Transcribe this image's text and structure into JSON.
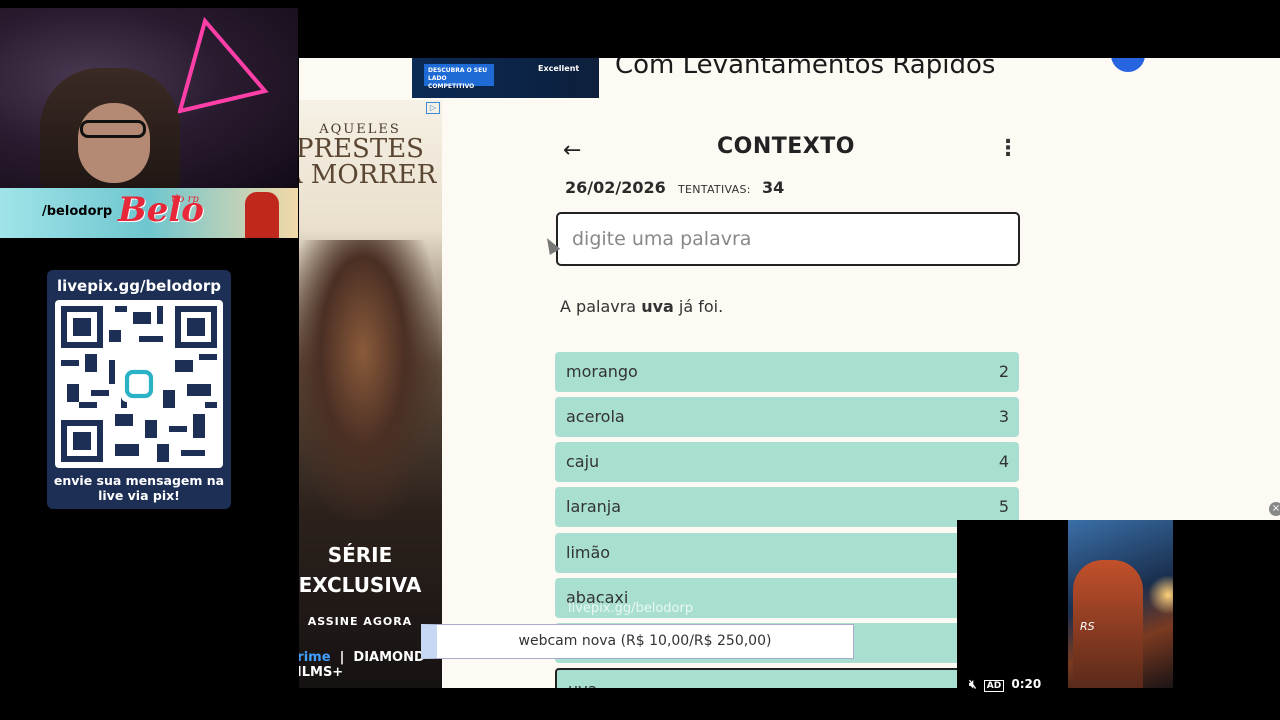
{
  "stream": {
    "handle": "/belodorp",
    "logo_text": "Belo",
    "logo_sub": "do rp",
    "livepix": {
      "url": "livepix.gg/belodorp",
      "message_line1": "envie sua mensagem na",
      "message_line2": "live via pix!"
    },
    "watermark": "livepix.gg/belodorp",
    "donation_text": "webcam nova (R$ 10,00/R$ 250,00)",
    "close_icon": "×",
    "video_time": "0:20",
    "video_ad_badge": "AD",
    "video_watermark": "RS"
  },
  "ads": {
    "top": {
      "badge_text": "DESCUBRA O SEU LADO COMPETITIVO",
      "badge2_text": "Excellent",
      "headline": "Com Levantamentos Rápidos"
    },
    "side": {
      "title_small": "AQUELES",
      "title_big1": "PRESTES",
      "title_big2": "A MORRER",
      "serie_line1": "SÉRIE",
      "serie_line2": "EXCLUSIVA",
      "cta": "ASSINE AGORA",
      "logo1": "prime",
      "logo2": "DIAMOND FILMS+"
    }
  },
  "game": {
    "title": "CONTEXTO",
    "back_icon": "←",
    "menu_icon": "⋮",
    "date": "26/02/2026",
    "tries_label": "TENTATIVAS:",
    "tries_value": "34",
    "input_placeholder": "digite uma palavra",
    "notice_prefix": "A palavra",
    "notice_word": "uva",
    "notice_suffix": "já foi.",
    "guesses": [
      {
        "word": "morango",
        "rank": "2"
      },
      {
        "word": "acerola",
        "rank": "3"
      },
      {
        "word": "caju",
        "rank": "4"
      },
      {
        "word": "laranja",
        "rank": "5"
      },
      {
        "word": "limão",
        "rank": ""
      },
      {
        "word": "abacaxi",
        "rank": ""
      },
      {
        "word": "",
        "rank": ""
      },
      {
        "word": "uva",
        "rank": ""
      }
    ]
  },
  "colors": {
    "guess_bg": "#a8dfd1",
    "page_bg": "#fdfaf4",
    "livepix_bg": "#1d2f55"
  }
}
